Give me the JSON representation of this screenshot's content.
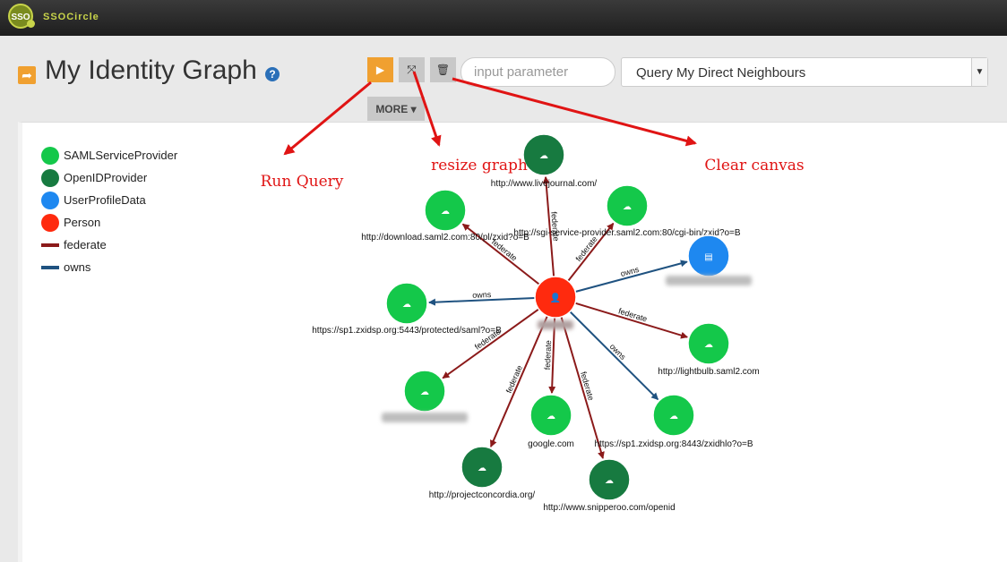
{
  "app": {
    "logo_mark": "SSO",
    "brand": "SSOCircle"
  },
  "header": {
    "title": "My Identity Graph",
    "title_icon": "share-arrow-icon",
    "help_icon": "question-mark-icon",
    "help_text": "?"
  },
  "toolbar": {
    "run_icon": "play-icon",
    "run_glyph": "▶",
    "resize_icon": "expand-arrows-icon",
    "resize_glyph": "⤧",
    "clear_icon": "trash-icon",
    "clear_glyph": "🗑",
    "parameter_placeholder": "input parameter",
    "query_selected": "Query My Direct Neighbours",
    "more_label": "MORE ▾"
  },
  "legend": [
    {
      "label": "SAMLServiceProvider",
      "type": "node",
      "color": "#14c84a"
    },
    {
      "label": "OpenIDProvider",
      "type": "node",
      "color": "#177a40"
    },
    {
      "label": "UserProfileData",
      "type": "node",
      "color": "#1e88f0"
    },
    {
      "label": "Person",
      "type": "node",
      "color": "#ff2a0e"
    },
    {
      "label": "federate",
      "type": "edge",
      "color": "#8b1a1a"
    },
    {
      "label": "owns",
      "type": "edge",
      "color": "#1f5280"
    }
  ],
  "colors": {
    "saml": "#14c84a",
    "openid": "#177a40",
    "profile": "#1e88f0",
    "person": "#ff2a0e",
    "federate": "#8b1a1a",
    "owns": "#1f5280",
    "accent": "#f0a030",
    "annotation": "#e01414"
  },
  "graph": {
    "center": {
      "type": "person",
      "label": "",
      "blurred": true
    },
    "nodes": [
      {
        "label": "http://www.livejournal.com/",
        "type": "openid",
        "edge": "federate"
      },
      {
        "label": "http://download.saml2.com:80/pl/zxid?o=B",
        "type": "saml",
        "edge": "federate"
      },
      {
        "label": "http://sgi-service-provider.saml2.com:80/cgi-bin/zxid?o=B",
        "type": "saml",
        "edge": "federate"
      },
      {
        "label": "",
        "type": "profile",
        "edge": "owns",
        "blurred": true
      },
      {
        "label": "https://sp1.zxidsp.org:5443/protected/saml?o=B",
        "type": "saml",
        "edge": "owns"
      },
      {
        "label": "http://lightbulb.saml2.com",
        "type": "saml",
        "edge": "federate"
      },
      {
        "label": "",
        "type": "saml",
        "edge": "federate",
        "blurred": true
      },
      {
        "label": "google.com",
        "type": "saml",
        "edge": "federate"
      },
      {
        "label": "https://sp1.zxidsp.org:8443/zxidhlo?o=B",
        "type": "saml",
        "edge": "owns"
      },
      {
        "label": "http://projectconcordia.org/",
        "type": "openid",
        "edge": "federate"
      },
      {
        "label": "http://www.snipperoo.com/openid",
        "type": "openid",
        "edge": "federate"
      }
    ]
  },
  "annotations": [
    {
      "label": "Run Query",
      "target": "run-button"
    },
    {
      "label": "resize graph",
      "target": "resize-button"
    },
    {
      "label": "Clear canvas",
      "target": "clear-button"
    }
  ]
}
